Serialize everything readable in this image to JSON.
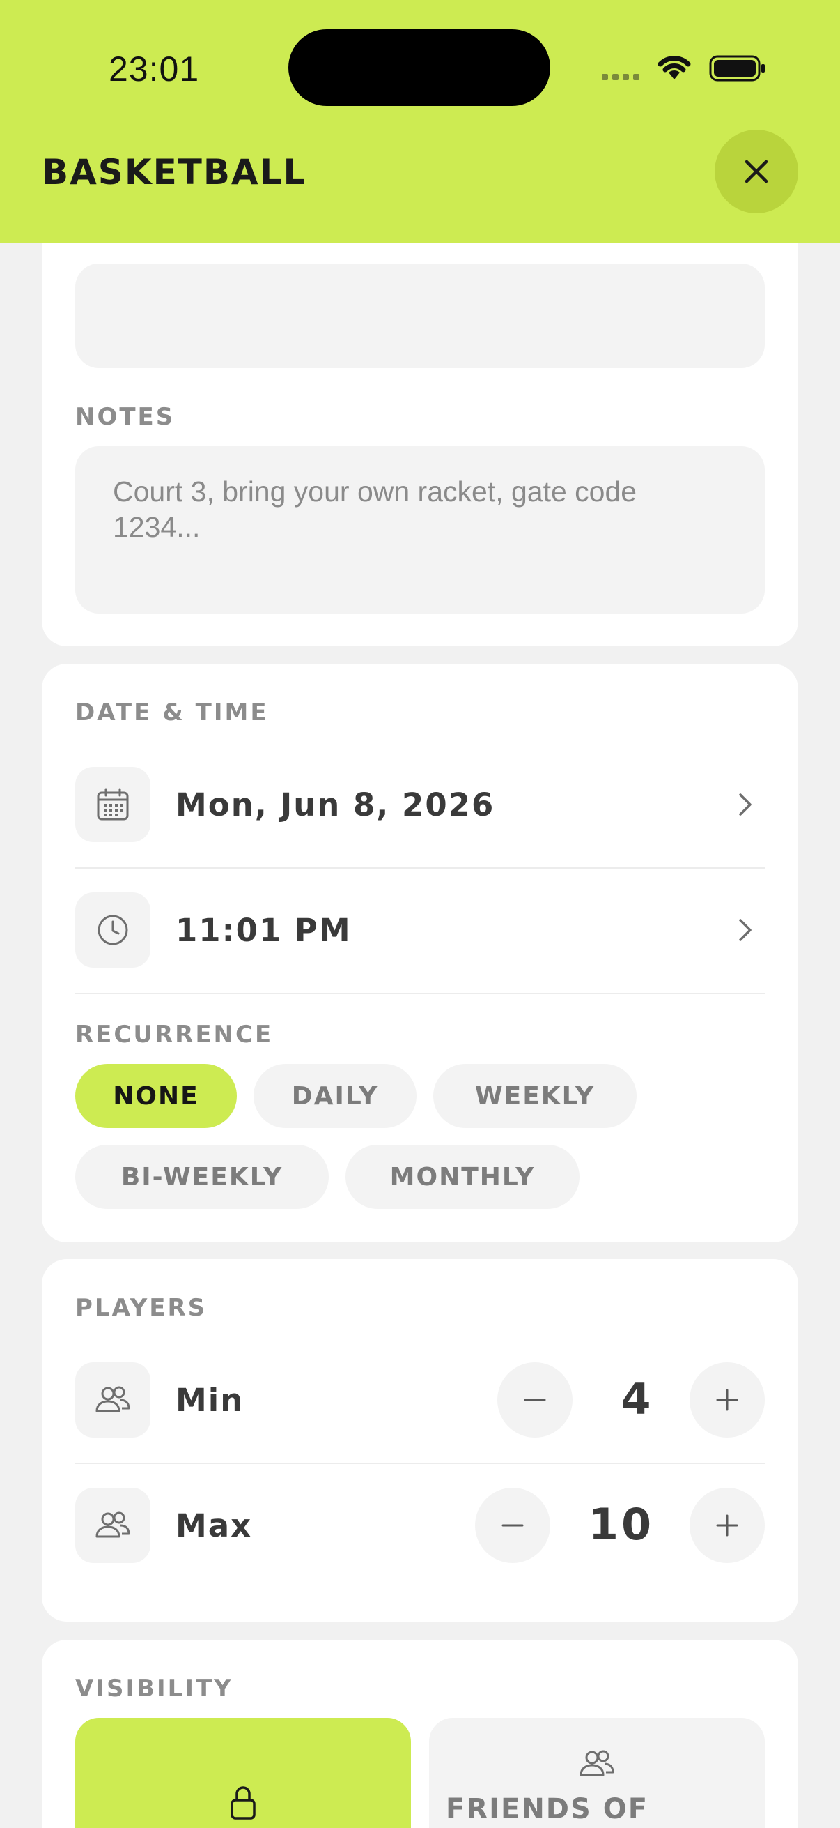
{
  "colors": {
    "accent": "#cdeb52",
    "muted_text": "#8c8c8c",
    "field_bg": "#f3f3f3"
  },
  "status_bar": {
    "time": "23:01"
  },
  "header": {
    "title": "BASKETBALL",
    "close_icon": "close-icon"
  },
  "notes": {
    "label": "NOTES",
    "placeholder": "Court 3, bring your own racket, gate code 1234..."
  },
  "date_time": {
    "label": "DATE & TIME",
    "date": "Mon, Jun 8, 2026",
    "time": "11:01 PM",
    "date_icon": "calendar-icon",
    "time_icon": "clock-icon"
  },
  "recurrence": {
    "label": "RECURRENCE",
    "options": [
      "NONE",
      "DAILY",
      "WEEKLY",
      "BI-WEEKLY",
      "MONTHLY"
    ],
    "selected": "NONE"
  },
  "players": {
    "label": "PLAYERS",
    "min": {
      "label": "Min",
      "value": "4"
    },
    "max": {
      "label": "Max",
      "value": "10"
    }
  },
  "visibility": {
    "label": "VISIBILITY",
    "options": [
      {
        "label": "",
        "icon": "lock-icon",
        "selected": true
      },
      {
        "label": "FRIENDS OF",
        "icon": "people-icon",
        "selected": false
      }
    ]
  }
}
